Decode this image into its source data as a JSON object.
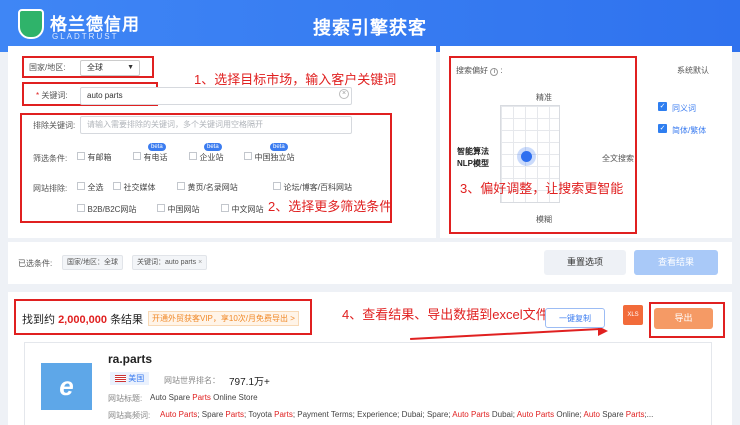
{
  "header": {
    "logo_text": "格兰德信用",
    "logo_sub": "GLADTRUST",
    "title": "搜索引擎获客"
  },
  "filters": {
    "country_label": "国家/地区:",
    "country_value": "全球",
    "keyword_label": "* 关键词:",
    "keyword_value": "auto parts",
    "exclude_label": "排除关键词:",
    "exclude_placeholder": "请输入需要排除的关键词，多个关键词用空格隔开",
    "conditions_label": "筛选条件:",
    "conditions": [
      "有邮箱",
      "有电话",
      "企业站",
      "中国独立站"
    ],
    "beta": "beta",
    "sites_label": "网站排除:",
    "sites_row1": [
      "全选",
      "社交媒体",
      "黄页/名录网站",
      "论坛/博客/百科网站"
    ],
    "sites_row2": [
      "B2B/B2C网站",
      "中国网站",
      "中文网站"
    ]
  },
  "annotations": {
    "a1": "1、选择目标市场，输入客户关键词",
    "a2": "2、选择更多筛选条件",
    "a3": "3、偏好调整，让搜索更智能",
    "a4": "4、查看结果、导出数据到excel文件"
  },
  "preference": {
    "label": "搜索偏好",
    "default_label": "系统默认",
    "top": "精准",
    "bottom": "模糊",
    "left_line1": "智能算法",
    "left_line2": "NLP模型",
    "right": "全文搜索",
    "option1": "同义词",
    "option2": "简体/繁体"
  },
  "selected": {
    "label": "已选条件:",
    "tags": [
      "国家/地区：全球",
      "关键词：auto parts"
    ],
    "reset": "重置选项",
    "view": "查看结果"
  },
  "results": {
    "prefix": "找到约",
    "count": "2,000,000",
    "suffix": "条结果",
    "promo": "开通外贸获客VIP，享10次/月免费导出 >",
    "copy": "一键复制",
    "xls": "XLS",
    "export": "导出"
  },
  "result_item": {
    "domain": "ra.parts",
    "flag_country": "美国",
    "rank_label": "网站世界排名：",
    "rank_value": "797.1万+",
    "title_label": "网站标题:",
    "title_value": "Auto Spare Parts Online Store",
    "keywords_label": "网站高频词:",
    "keywords_value": "Auto Parts; Spare Parts; Toyota Parts; Payment Terms; Experience; Dubai; Spare; Auto Parts Dubai; Auto Parts Online; Auto Spare Parts;..."
  },
  "colors": {
    "header": "#3f86f5",
    "accent": "#2e7ef0",
    "annotation": "#e02020",
    "export_btn": "#f59a65"
  }
}
